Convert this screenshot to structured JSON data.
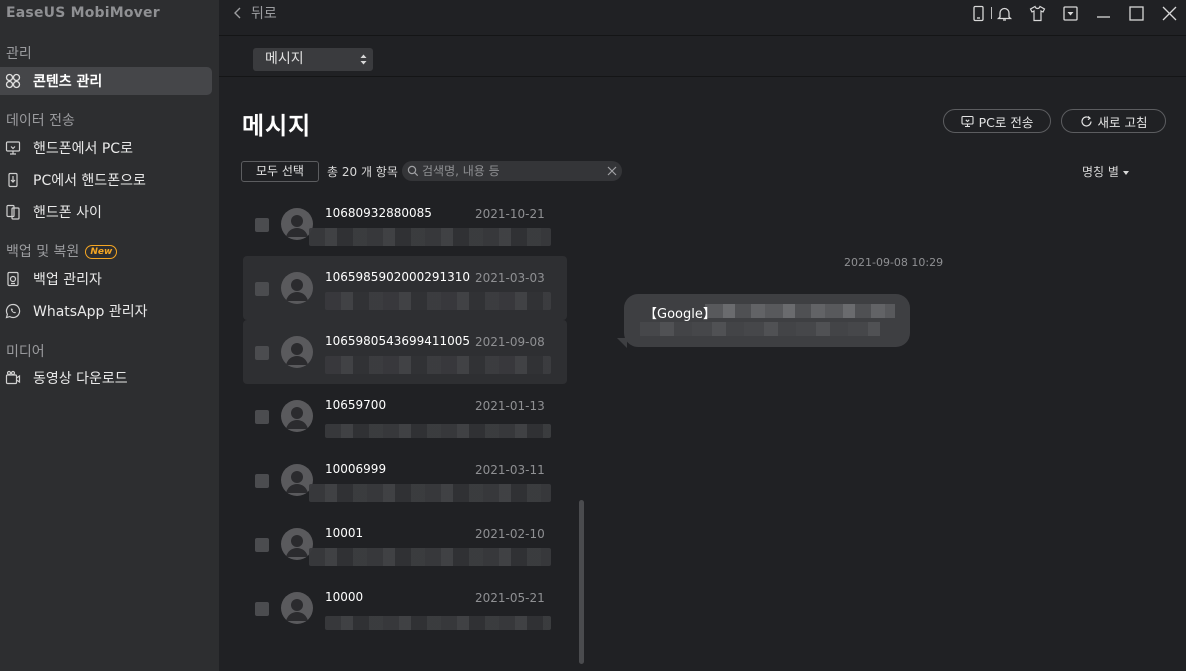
{
  "app": {
    "title": "EaseUS MobiMover"
  },
  "sidebar": {
    "sections": [
      {
        "header": "관리",
        "items": [
          {
            "label": "콘텐츠 관리",
            "icon": "grid-icon",
            "active": true
          }
        ]
      },
      {
        "header": "데이터 전송",
        "items": [
          {
            "label": "핸드폰에서 PC로",
            "icon": "phone-to-pc-icon"
          },
          {
            "label": "PC에서 핸드폰으로",
            "icon": "pc-to-phone-icon"
          },
          {
            "label": "핸드폰 사이",
            "icon": "phone-to-phone-icon"
          }
        ]
      },
      {
        "header": "백업 및 복원",
        "badge": "New",
        "items": [
          {
            "label": "백업 관리자",
            "icon": "backup-icon"
          },
          {
            "label": "WhatsApp 관리자",
            "icon": "whatsapp-icon"
          }
        ]
      },
      {
        "header": "미디어",
        "items": [
          {
            "label": "동영상 다운로드",
            "icon": "video-download-icon"
          }
        ]
      }
    ]
  },
  "topbar": {
    "back_label": "뒤로"
  },
  "category_dropdown": {
    "selected": "메시지"
  },
  "main": {
    "title": "메시지",
    "to_pc_label": "PC로 전송",
    "refresh_label": "새로 고침",
    "select_all_label": "모두 선택",
    "count_text": "총 20 개 항목",
    "search_placeholder": "검색명, 내용 등",
    "sort_label": "명칭 별"
  },
  "conversations": [
    {
      "name": "10680932880085",
      "date": "2021-10-21"
    },
    {
      "name": "1065985902000291310",
      "date": "2021-03-03"
    },
    {
      "name": "1065980543699411005",
      "date": "2021-09-08"
    },
    {
      "name": "10659700",
      "date": "2021-01-13"
    },
    {
      "name": "10006999",
      "date": "2021-03-11"
    },
    {
      "name": "10001",
      "date": "2021-02-10"
    },
    {
      "name": "10000",
      "date": "2021-05-21"
    }
  ],
  "detail": {
    "timestamp": "2021-09-08 10:29",
    "message_prefix": "【Google】"
  },
  "colors": {
    "background": "#202124",
    "sidebar": "#2d2e30",
    "badge": "#f5a623"
  }
}
